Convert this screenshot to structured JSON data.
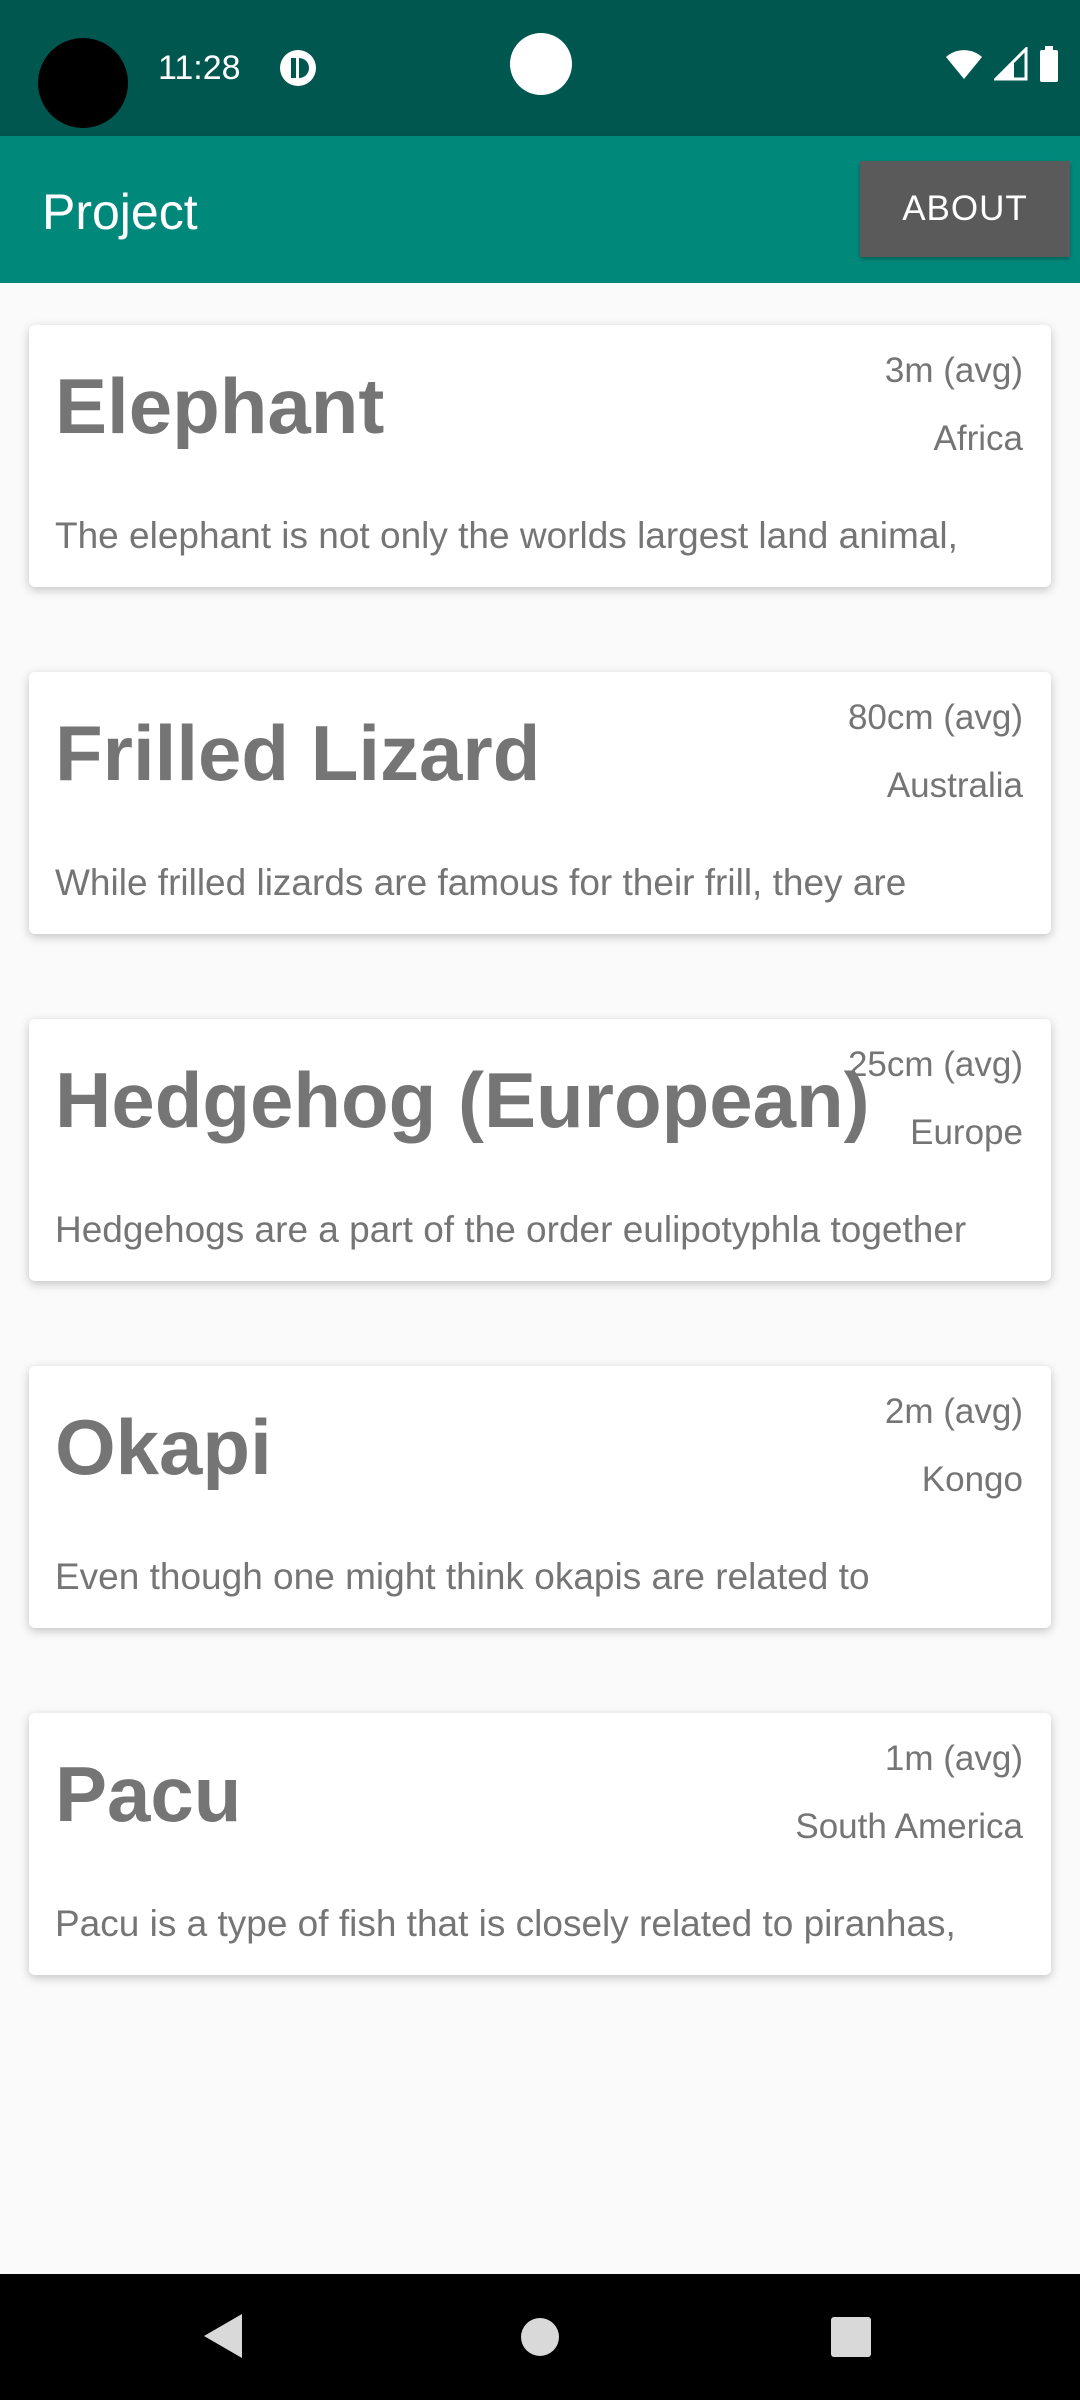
{
  "status_bar": {
    "time": "11:28",
    "icons": [
      "app-notification-icon",
      "wifi-icon",
      "signal-icon",
      "battery-icon"
    ]
  },
  "app_bar": {
    "title": "Project",
    "about_label": "ABOUT"
  },
  "animals": [
    {
      "name": "Elephant",
      "size": "3m (avg)",
      "region": "Africa",
      "description": "The elephant is not only the worlds largest land animal,"
    },
    {
      "name": "Frilled Lizard",
      "size": "80cm (avg)",
      "region": "Australia",
      "description": "While frilled lizards are famous for their frill, they are"
    },
    {
      "name": "Hedgehog (European)",
      "size": "25cm (avg)",
      "region": "Europe",
      "description": "Hedgehogs are a part of the order eulipotyphla together"
    },
    {
      "name": "Okapi",
      "size": "2m (avg)",
      "region": "Kongo",
      "description": "Even though one might think okapis are related to"
    },
    {
      "name": "Pacu",
      "size": "1m (avg)",
      "region": "South America",
      "description": "Pacu is a type of fish that is closely related to piranhas,"
    }
  ],
  "nav_bar": {
    "icons": [
      "back-icon",
      "home-icon",
      "recents-icon"
    ]
  },
  "colors": {
    "status_bar": "#00574f",
    "app_bar": "#00897b",
    "about_button": "#5a5a5a",
    "card_text": "#757575",
    "background": "#fafafa"
  }
}
